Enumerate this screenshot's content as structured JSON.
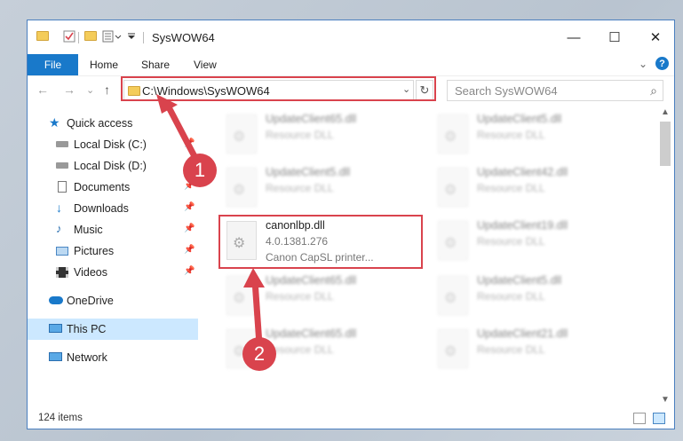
{
  "window": {
    "title": "SysWOW64",
    "minimize": "—",
    "maximize": "☐",
    "close": "✕"
  },
  "ribbon": {
    "file": "File",
    "home": "Home",
    "share": "Share",
    "view": "View",
    "expand": "⌄",
    "help": "?"
  },
  "nav": {
    "back": "←",
    "forward": "→",
    "recent": "⌄",
    "up": "↑",
    "address": "C:\\Windows\\SysWOW64",
    "address_drop": "⌄",
    "refresh": "↻",
    "search_placeholder": "Search SysWOW64",
    "search_icon": "⌕"
  },
  "navpane": {
    "items": [
      {
        "label": "Quick access",
        "icon": "star-icon"
      },
      {
        "label": "Local Disk (C:)",
        "icon": "drive-icon"
      },
      {
        "label": "Local Disk (D:)",
        "icon": "drive-icon"
      },
      {
        "label": "Documents",
        "icon": "documents-icon"
      },
      {
        "label": "Downloads",
        "icon": "download-icon"
      },
      {
        "label": "Music",
        "icon": "music-icon"
      },
      {
        "label": "Pictures",
        "icon": "pictures-icon"
      },
      {
        "label": "Videos",
        "icon": "videos-icon"
      },
      {
        "label": "OneDrive",
        "icon": "cloud-icon"
      },
      {
        "label": "This PC",
        "icon": "pc-icon"
      },
      {
        "label": "Network",
        "icon": "network-icon"
      }
    ],
    "pin": "📌"
  },
  "files": {
    "left": [
      {
        "name": "UpdateClient65.dll",
        "desc": "Resource DLL"
      },
      {
        "name": "UpdateClient5.dll",
        "desc": "Resource DLL"
      },
      {
        "name": "canonlbp.dll",
        "version": "4.0.1381.276",
        "desc": "Canon CapSL printer..."
      },
      {
        "name": "UpdateClient65.dll",
        "desc": "Resource DLL"
      },
      {
        "name": "UpdateClient65.dll",
        "desc": "Resource DLL"
      }
    ],
    "right": [
      {
        "name": "UpdateClient5.dll",
        "desc": "Resource DLL"
      },
      {
        "name": "UpdateClient42.dll",
        "desc": "Resource DLL"
      },
      {
        "name": "UpdateClient19.dll",
        "desc": "Resource DLL"
      },
      {
        "name": "UpdateClient5.dll",
        "desc": "Resource DLL"
      },
      {
        "name": "UpdateClient21.dll",
        "desc": "Resource DLL"
      }
    ]
  },
  "status": {
    "items": "124 items"
  },
  "annotations": {
    "step1": "1",
    "step2": "2",
    "color": "#d9434d"
  }
}
